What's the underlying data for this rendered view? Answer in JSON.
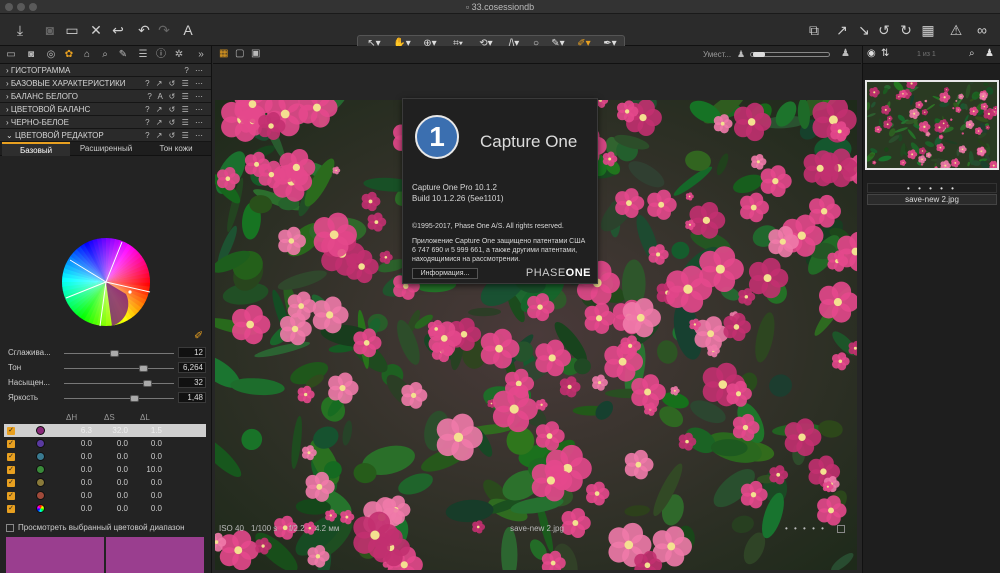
{
  "window": {
    "title": "33.cosessiondb"
  },
  "left_panel": {
    "sections": [
      {
        "label": "ГИСТОГРАММА",
        "controls": "? ⋯",
        "expanded": false
      },
      {
        "label": "БАЗОВЫЕ ХАРАКТЕРИСТИКИ",
        "controls": "? ↗ ↺ ☰ ⋯",
        "expanded": false
      },
      {
        "label": "БАЛАНС БЕЛОГО",
        "controls": "? A ↺ ☰ ⋯",
        "expanded": false
      },
      {
        "label": "ЦВЕТОВОЙ БАЛАНС",
        "controls": "? ↗ ↺ ☰ ⋯",
        "expanded": false
      },
      {
        "label": "ЧЕРНО-БЕЛОЕ",
        "controls": "? ↗ ↺ ☰ ⋯",
        "expanded": false
      },
      {
        "label": "ЦВЕТОВОЙ РЕДАКТОР",
        "controls": "? ↗ ↺ ☰ ⋯",
        "expanded": true
      }
    ],
    "tabs": [
      {
        "label": "Базовый",
        "selected": true
      },
      {
        "label": "Расширенный",
        "selected": false
      },
      {
        "label": "Тон кожи",
        "selected": false
      }
    ],
    "sliders": [
      {
        "label": "Сглажива...",
        "value": "12",
        "pos": 0.42
      },
      {
        "label": "Тон",
        "value": "6,264",
        "pos": 0.68
      },
      {
        "label": "Насыщен...",
        "value": "32",
        "pos": 0.72
      },
      {
        "label": "Яркость",
        "value": "1,48",
        "pos": 0.6
      }
    ],
    "table": {
      "headers": [
        "ΔH",
        "ΔS",
        "ΔL"
      ],
      "rows": [
        {
          "color": "#8a2a7a",
          "h": "6.3",
          "s": "32.0",
          "l": "1.5",
          "selected": true
        },
        {
          "color": "#5a3aa0",
          "h": "0.0",
          "s": "0.0",
          "l": "0.0",
          "selected": false
        },
        {
          "color": "#3a7a90",
          "h": "0.0",
          "s": "0.0",
          "l": "0.0",
          "selected": false
        },
        {
          "color": "#3a8a3a",
          "h": "0.0",
          "s": "0.0",
          "l": "10.0",
          "selected": false
        },
        {
          "color": "#8a7a3a",
          "h": "0.0",
          "s": "0.0",
          "l": "0.0",
          "selected": false
        },
        {
          "color": "#a04a3a",
          "h": "0.0",
          "s": "0.0",
          "l": "0.0",
          "selected": false
        },
        {
          "color": "multi",
          "h": "0.0",
          "s": "0.0",
          "l": "0.0",
          "selected": false
        }
      ]
    },
    "preview_checkbox": "Просмотреть выбранный цветовой диапазон",
    "swatch_color": "#9a3e8f"
  },
  "viewer": {
    "top_label": "Умест...",
    "filename": "save-new 2.jpg",
    "exif": {
      "iso": "ISO 40",
      "shutter": "1/100 s",
      "aperture": "f/2.2",
      "focal": "4.2 мм"
    }
  },
  "about": {
    "app_name": "Capture One",
    "version": "Capture One Pro 10.1.2",
    "build": "Build 10.1.2.26 (5ee1101)",
    "copyright": "©1995-2017, Phase One A/S. All rights reserved.",
    "patent_line1": "Приложение Capture One защищено патентами США",
    "patent_line2": "6 747 690 и 5 999 661, а также другими патентами,",
    "patent_line3": "находящимися на рассмотрении.",
    "info_button": "Информация...",
    "brand_left": "PHASE",
    "brand_right": "ONE"
  },
  "right_panel": {
    "counter": "1 из 1",
    "thumb_name": "save-new 2.jpg",
    "stars": "• • • • •"
  },
  "accent": "#e8a020"
}
